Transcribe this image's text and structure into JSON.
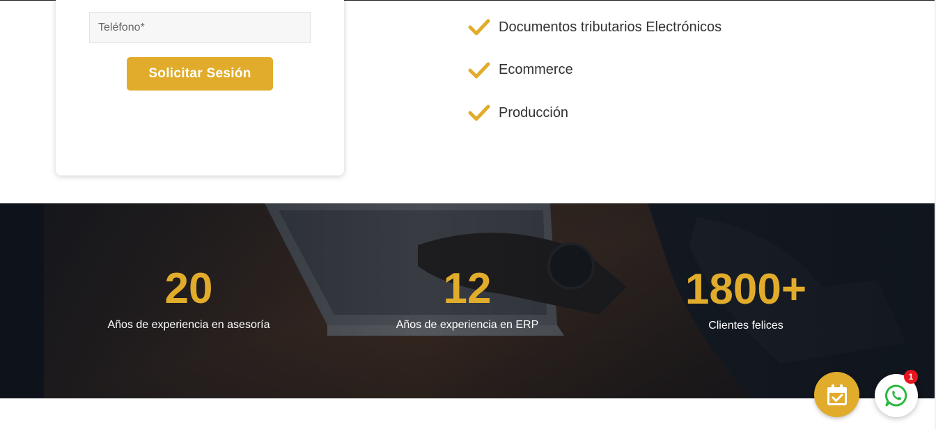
{
  "form": {
    "phone_placeholder": "Teléfono*",
    "submit_label": "Solicitar Sesión"
  },
  "features": {
    "items": [
      {
        "label": "Documentos tributarios Electrónicos",
        "icon": "check-icon"
      },
      {
        "label": "Ecommerce",
        "icon": "check-icon"
      },
      {
        "label": "Producción",
        "icon": "check-icon"
      }
    ]
  },
  "stats": {
    "items": [
      {
        "value": "20",
        "label": "Años de experiencia en asesoría"
      },
      {
        "value": "12",
        "label": "Años de experiencia en ERP"
      },
      {
        "value": "1800+",
        "label": "Clientes felices"
      }
    ]
  },
  "floating": {
    "calendar_icon": "calendar-check-icon",
    "whatsapp_icon": "whatsapp-icon",
    "whatsapp_badge": "1"
  },
  "colors": {
    "accent": "#e1ac2b",
    "band_bg": "#121821",
    "badge": "#e8141e"
  }
}
